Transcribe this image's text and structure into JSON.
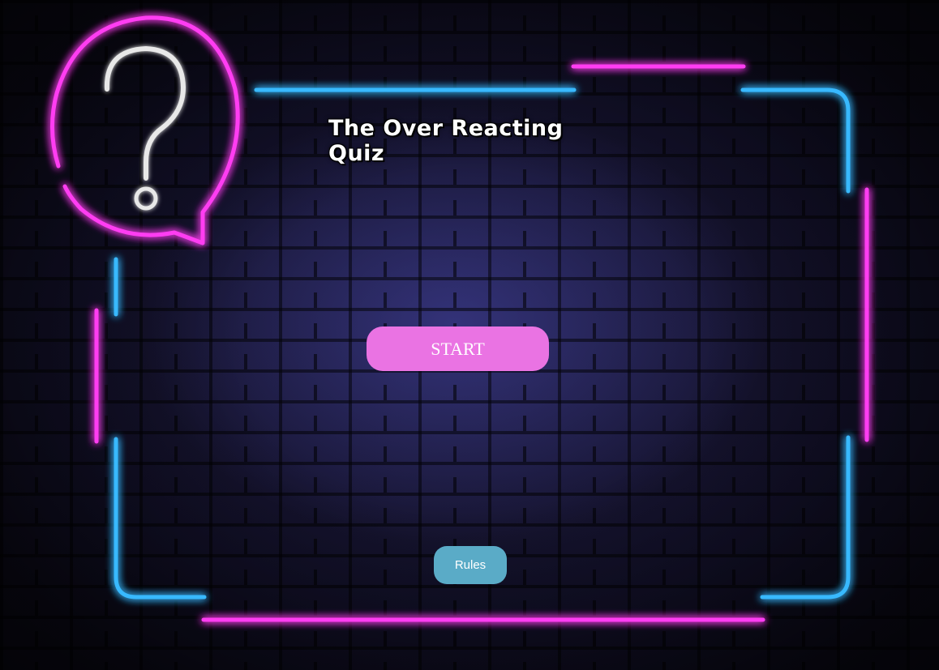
{
  "quiz": {
    "title": "The Over Reacting Quiz",
    "start_label": "START",
    "rules_label": "Rules"
  },
  "decor": {
    "icon": "question-mark-speech-bubble-icon",
    "neon_pink": "#ff3df2",
    "neon_blue": "#37b9ff"
  },
  "colors": {
    "start_button": "#ea73e3",
    "rules_button": "#5aabc7",
    "title_text": "#ffffff"
  }
}
